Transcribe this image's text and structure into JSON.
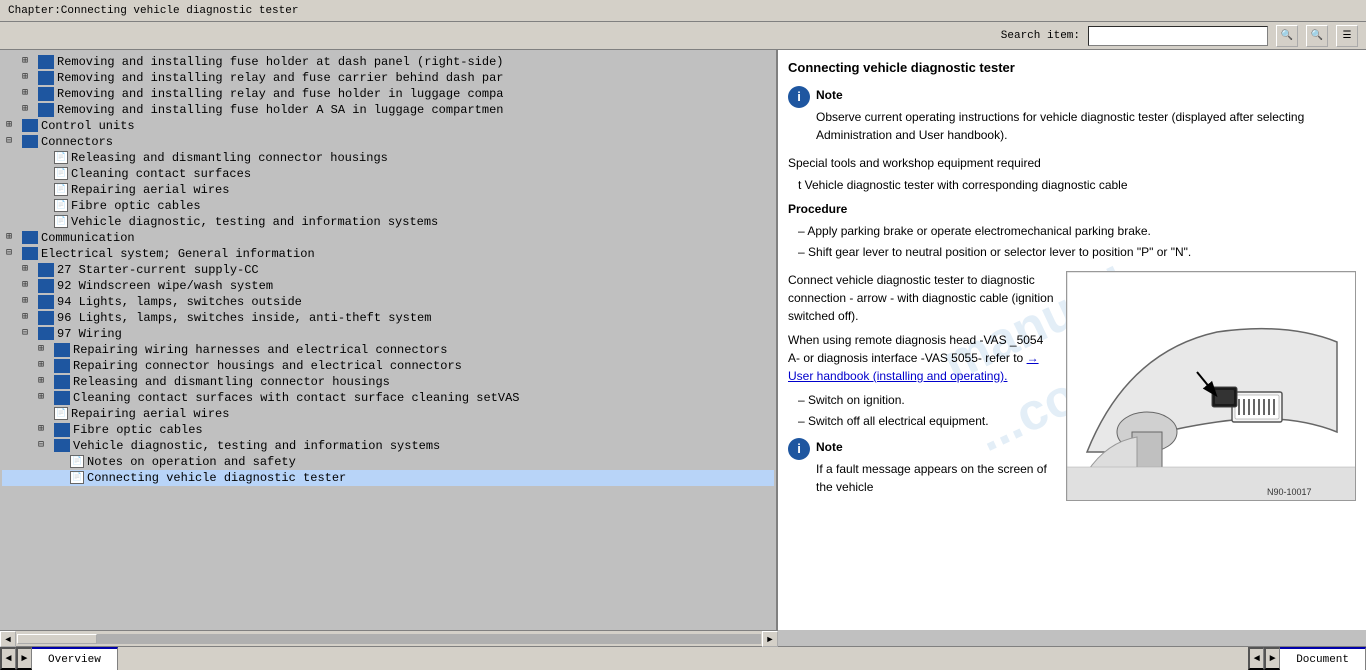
{
  "titleBar": {
    "text": "Chapter:Connecting vehicle diagnostic tester"
  },
  "toolbar": {
    "searchLabel": "Search item:",
    "searchValue": ""
  },
  "toc": {
    "items": [
      {
        "indent": 1,
        "type": "book",
        "expand": true,
        "text": "Removing and installing fuse holder at dash panel (right-side)"
      },
      {
        "indent": 1,
        "type": "book",
        "expand": true,
        "text": "Removing and installing relay and fuse carrier behind dash par"
      },
      {
        "indent": 1,
        "type": "book",
        "expand": true,
        "text": "Removing and installing relay and fuse holder in luggage comp"
      },
      {
        "indent": 1,
        "type": "book",
        "expand": true,
        "text": "Removing and installing fuse holder A SA in luggage compartmen"
      },
      {
        "indent": 0,
        "type": "folder",
        "expand": false,
        "text": "Control units"
      },
      {
        "indent": 0,
        "type": "folder",
        "expand": true,
        "text": "Connectors"
      },
      {
        "indent": 1,
        "type": "page",
        "text": "Releasing and dismantling connector housings"
      },
      {
        "indent": 1,
        "type": "page",
        "text": "Cleaning contact surfaces"
      },
      {
        "indent": 1,
        "type": "page",
        "text": "Repairing aerial wires"
      },
      {
        "indent": 1,
        "type": "page",
        "text": "Fibre optic cables"
      },
      {
        "indent": 1,
        "type": "page",
        "text": "Vehicle diagnostic, testing and information systems"
      },
      {
        "indent": 0,
        "type": "folder",
        "expand": false,
        "text": "Communication"
      },
      {
        "indent": 0,
        "type": "folder",
        "expand": false,
        "text": "Electrical system; General information"
      },
      {
        "indent": 0,
        "type": "folder",
        "expand": true,
        "text": ""
      },
      {
        "indent": 1,
        "type": "book",
        "expand": false,
        "text": "27 Starter-current supply-CC"
      },
      {
        "indent": 1,
        "type": "book",
        "expand": false,
        "text": "92 Windscreen wipe/wash system"
      },
      {
        "indent": 1,
        "type": "book",
        "expand": false,
        "text": "94 Lights, lamps, switches outside"
      },
      {
        "indent": 1,
        "type": "book",
        "expand": false,
        "text": "96 Lights, lamps, switches inside, anti-theft system"
      },
      {
        "indent": 1,
        "type": "folder",
        "expand": true,
        "text": "97 Wiring"
      },
      {
        "indent": 2,
        "type": "book",
        "expand": false,
        "text": "Repairing wiring harnesses and electrical connectors"
      },
      {
        "indent": 2,
        "type": "book",
        "expand": false,
        "text": "Repairing connector housings and electrical connectors"
      },
      {
        "indent": 2,
        "type": "book",
        "expand": false,
        "text": "Releasing and dismantling connector housings"
      },
      {
        "indent": 2,
        "type": "book",
        "expand": false,
        "text": "Cleaning contact surfaces with contact surface cleaning setVAS"
      },
      {
        "indent": 2,
        "type": "page",
        "text": "Repairing aerial wires"
      },
      {
        "indent": 2,
        "type": "book",
        "expand": false,
        "text": "Fibre optic cables"
      },
      {
        "indent": 2,
        "type": "folder",
        "expand": true,
        "text": "Vehicle diagnostic, testing and information systems"
      },
      {
        "indent": 3,
        "type": "page",
        "text": "Notes on operation and safety"
      },
      {
        "indent": 3,
        "type": "page",
        "text": "Connecting vehicle diagnostic tester"
      }
    ]
  },
  "document": {
    "title": "Connecting vehicle diagnostic tester",
    "noteLabel": "Note",
    "noteText": "Observe current operating instructions for vehicle diagnostic tester (displayed after selecting Administration and User handbook).",
    "specialToolsLabel": "Special tools and workshop equipment required",
    "toolItem": "t  Vehicle diagnostic tester with corresponding diagnostic cable",
    "procedureLabel": "Procedure",
    "steps": [
      "Apply parking brake or operate electromechanical parking brake.",
      "Shift gear lever to neutral position or selector lever to position \"P\" or \"N\"."
    ],
    "connectText": "Connect vehicle diagnostic tester to diagnostic connection - arrow- with diagnostic cable (ignition switched off).",
    "remoteText": "When using remote diagnosis head -VAS 5054 A- or diagnosis interface -VAS 5055- refer to",
    "linkText": "→ User handbook (installing and operating).",
    "step3": "Switch on ignition.",
    "step4": "Switch off all electrical equipment.",
    "note2Label": "Note",
    "note2Text": "If a fault message appears on the screen of the vehicle",
    "diagramRef": "N90-10017"
  },
  "statusBar": {
    "leftTabs": [
      "Overview"
    ],
    "navButtons": [
      "◄",
      "►"
    ],
    "rightTabs": [
      "Document"
    ]
  }
}
